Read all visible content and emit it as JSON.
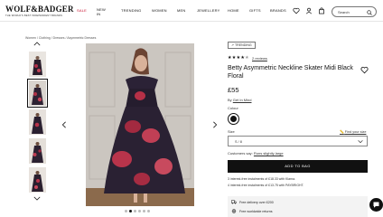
{
  "header": {
    "logo": "WOLF&BADGER",
    "tagline": "THE WORLD'S BEST INDEPENDENT BRANDS",
    "nav": [
      "SALE",
      "NEW IN",
      "TRENDING",
      "WOMEN",
      "MEN",
      "JEWELLERY",
      "HOME",
      "GIFTS",
      "BRANDS"
    ],
    "search_placeholder": "Search"
  },
  "breadcrumb": "Women / Clothing / Dresses / Asymmetric Dresses",
  "gallery": {
    "thumb_count": 5,
    "active_thumb": 2,
    "dot_count": 6,
    "active_dot": 1
  },
  "product": {
    "badge": "TRENDING",
    "rating": 4.5,
    "reviews": "2 reviews",
    "title": "Betty Asymmetric Neckline Skater Midi Black Floral",
    "price": "£55",
    "by_prefix": "By",
    "brand": "Get In Mind",
    "colour_label": "Colour",
    "size_label": "Size",
    "size_guide": "Find your size",
    "size_value": "S / 8",
    "fit_prefix": "Customers say:",
    "fit_value": "Runs slightly large",
    "add_to_bag": "ADD TO BAG",
    "installment_1": "3 interest-free instalments of £18.33 with Klarna.",
    "installment_2": "4 interest-free instalments of £13.75 with PAYBRIGHT.",
    "delivery_1": "Free delivery over £200",
    "delivery_2": "Free worldwide returns"
  },
  "colors": {
    "sale": "#c8102e",
    "button": "#111111",
    "swatch": "#111111"
  }
}
